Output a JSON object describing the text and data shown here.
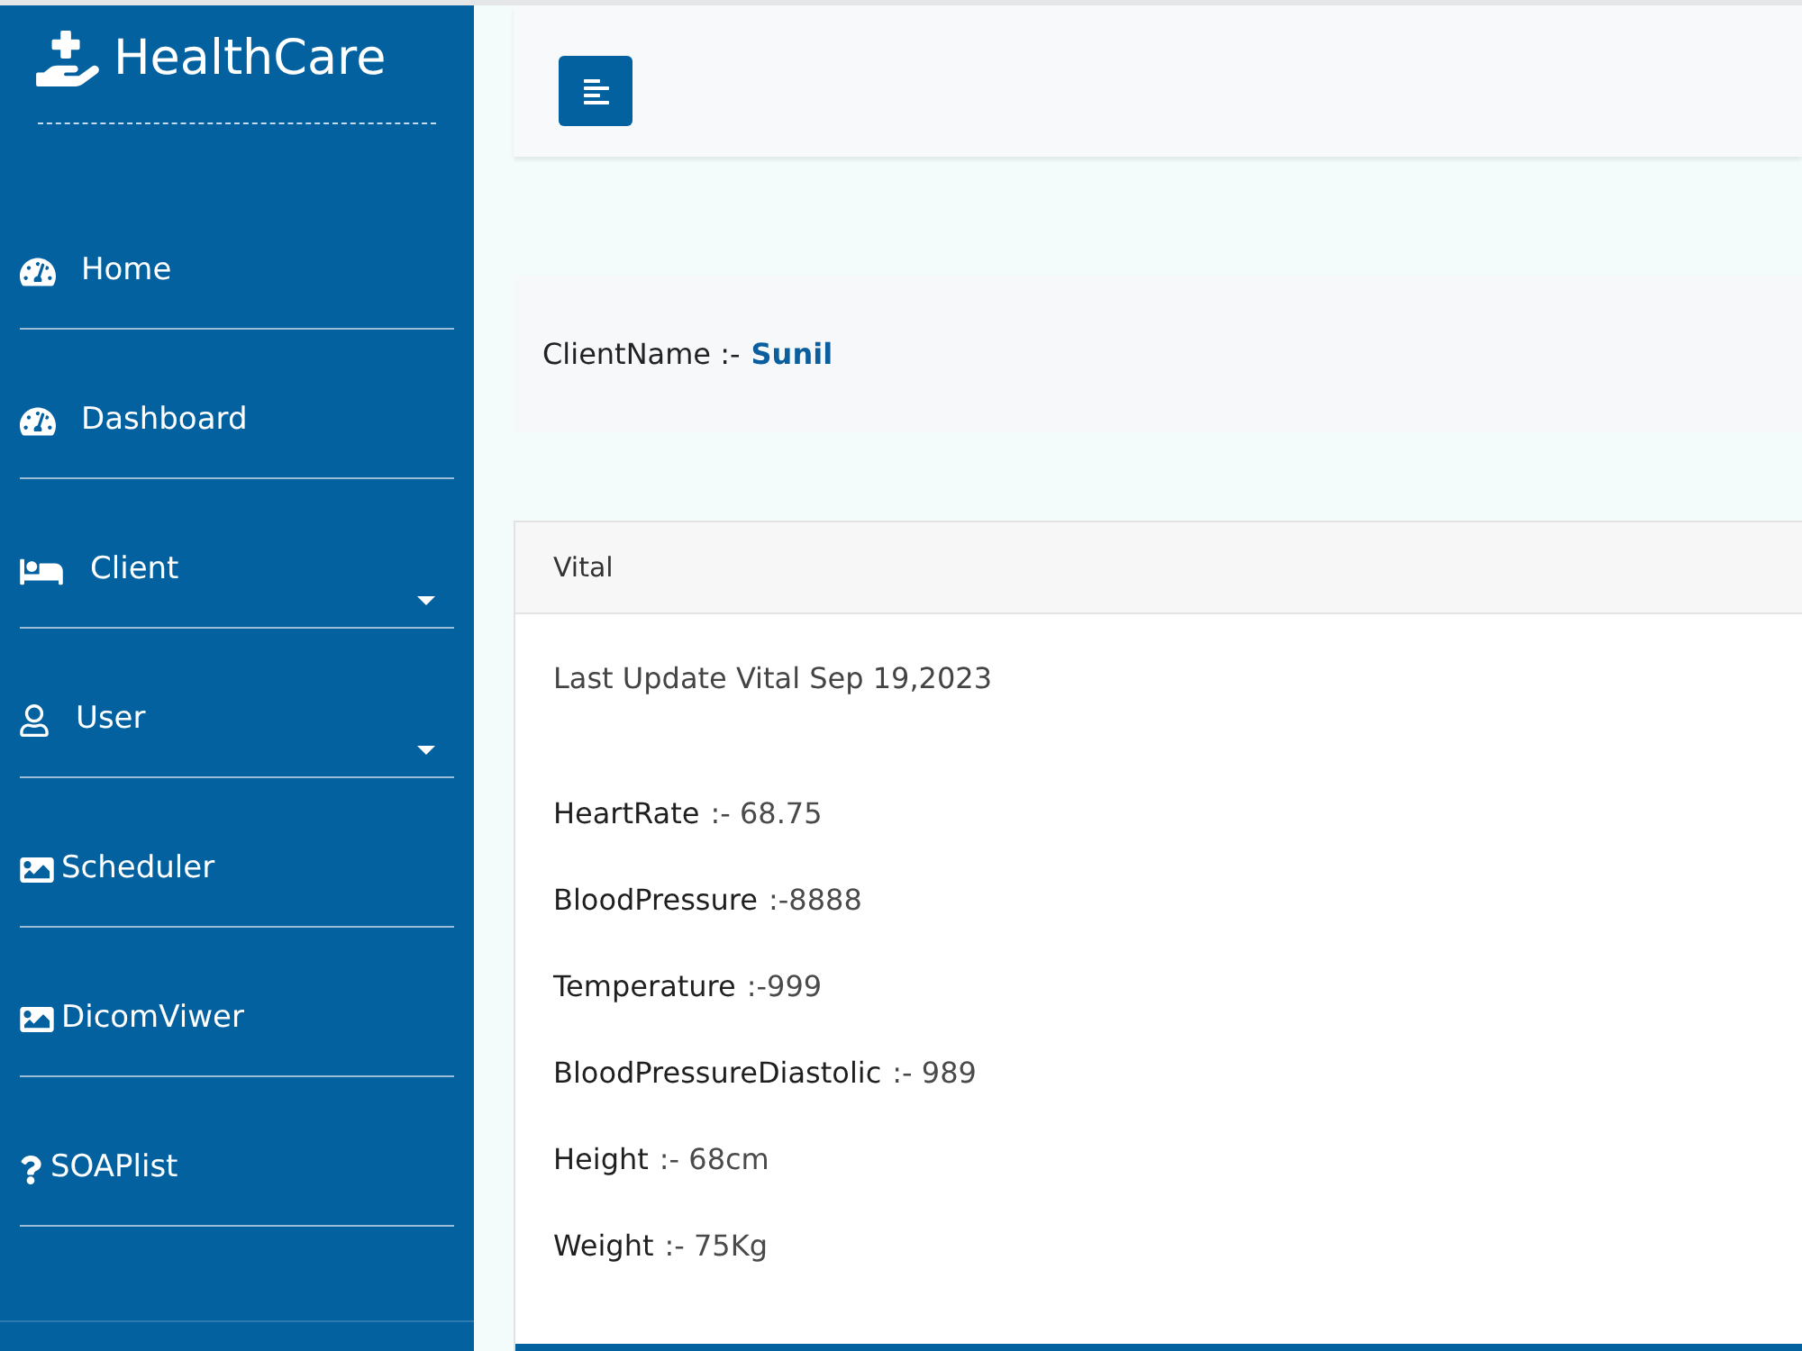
{
  "sidebar": {
    "brand": "HealthCare",
    "items": [
      {
        "label": "Home",
        "has_submenu": false
      },
      {
        "label": "Dashboard",
        "has_submenu": false
      },
      {
        "label": "Client",
        "has_submenu": true
      },
      {
        "label": "User",
        "has_submenu": true
      },
      {
        "label": "Scheduler",
        "has_submenu": false
      },
      {
        "label": "DicomViwer",
        "has_submenu": false
      },
      {
        "label": "SOAPlist",
        "has_submenu": false
      }
    ]
  },
  "client": {
    "label": "ClientName :-",
    "name": "Sunil"
  },
  "vital": {
    "title": "Vital",
    "last_update": "Last Update Vital Sep 19,2023",
    "readings": [
      {
        "label": "HeartRate",
        "value": ":- 68.75"
      },
      {
        "label": "BloodPressure",
        "value": ":-8888"
      },
      {
        "label": "Temperature",
        "value": ":-999"
      },
      {
        "label": "BloodPressureDiastolic",
        "value": ":- 989"
      },
      {
        "label": "Height",
        "value": ":- 68cm"
      },
      {
        "label": "Weight",
        "value": ":- 75Kg"
      }
    ]
  }
}
